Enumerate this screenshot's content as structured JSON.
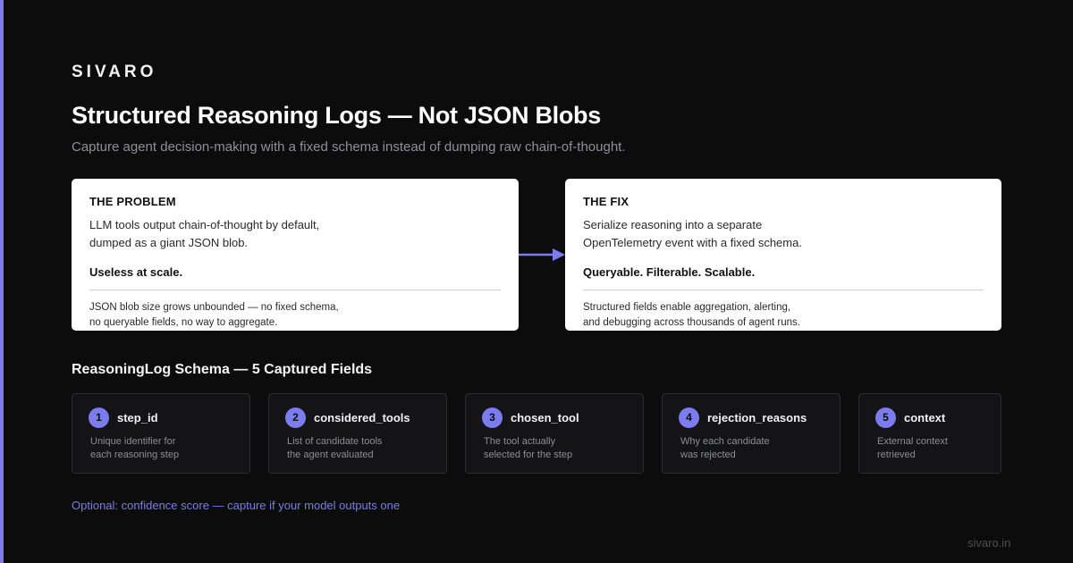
{
  "brand": "SIVARO",
  "title": "Structured Reasoning Logs — Not JSON Blobs",
  "subtitle": "Capture agent decision-making with a fixed schema instead of dumping raw chain-of-thought.",
  "problem": {
    "heading": "THE PROBLEM",
    "body_line1": "LLM tools output chain-of-thought by default,",
    "body_line2": "dumped as a giant JSON blob.",
    "emphasis": "Useless at scale.",
    "note_line1": "JSON blob size grows unbounded — no fixed schema,",
    "note_line2": "no queryable fields, no way to aggregate."
  },
  "fix": {
    "heading": "THE FIX",
    "body_line1": "Serialize reasoning into a separate",
    "body_line2": "OpenTelemetry event with a fixed schema.",
    "emphasis": "Queryable. Filterable. Scalable.",
    "note_line1": "Structured fields enable aggregation, alerting,",
    "note_line2": "and debugging across thousands of agent runs."
  },
  "schema": {
    "title": "ReasoningLog Schema — 5 Captured Fields",
    "fields": [
      {
        "num": "1",
        "name": "step_id",
        "desc_line1": "Unique identifier for",
        "desc_line2": "each reasoning step"
      },
      {
        "num": "2",
        "name": "considered_tools",
        "desc_line1": "List of candidate tools",
        "desc_line2": "the agent evaluated"
      },
      {
        "num": "3",
        "name": "chosen_tool",
        "desc_line1": "The tool actually",
        "desc_line2": "selected for the step"
      },
      {
        "num": "4",
        "name": "rejection_reasons",
        "desc_line1": "Why each candidate",
        "desc_line2": "was rejected"
      },
      {
        "num": "5",
        "name": "context",
        "desc_line1": "External context",
        "desc_line2": "retrieved"
      }
    ]
  },
  "optional_note": "Optional: confidence score — capture if your model outputs one",
  "footer": "sivaro.in",
  "colors": {
    "accent": "#7b7cf0",
    "background": "#0c0c0d",
    "card": "#ffffff"
  }
}
